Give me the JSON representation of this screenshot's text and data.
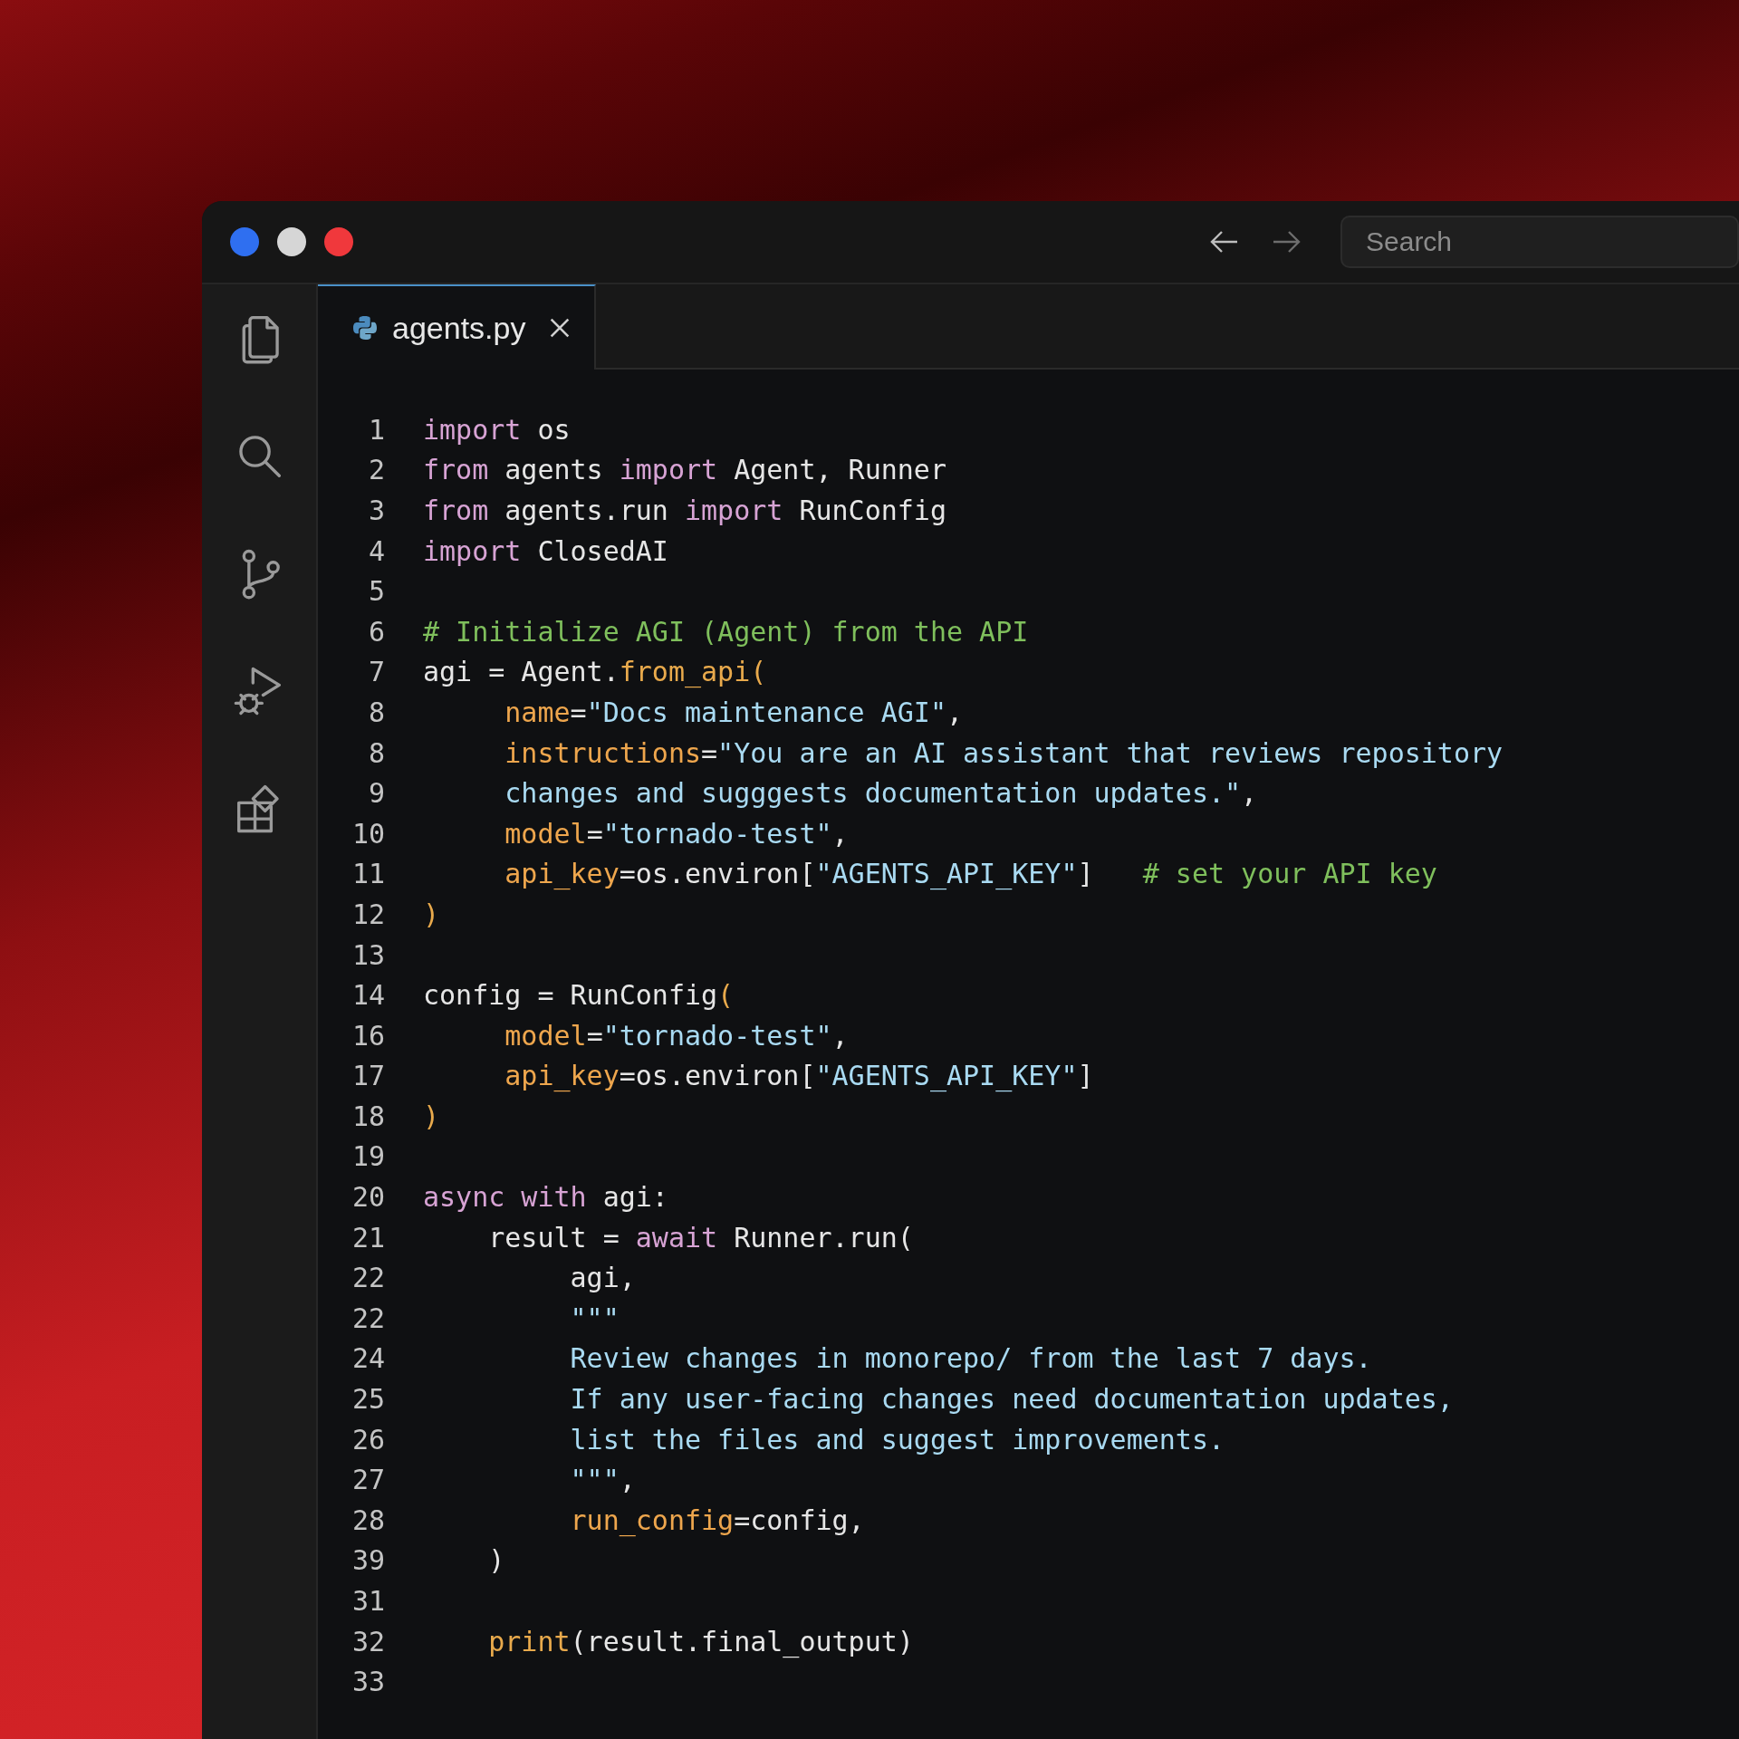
{
  "window": {
    "traffic_lights": [
      {
        "color": "#2f6ff0"
      },
      {
        "color": "#d6d6d6"
      },
      {
        "color": "#f0383c"
      }
    ],
    "search": {
      "placeholder": "Search"
    }
  },
  "activity_bar": {
    "items": [
      {
        "kind": "files",
        "selected": false
      },
      {
        "kind": "search",
        "selected": false
      },
      {
        "kind": "source-control",
        "selected": false
      },
      {
        "kind": "run-debug",
        "selected": false
      },
      {
        "kind": "extensions",
        "selected": false
      }
    ]
  },
  "tabs": [
    {
      "label": "agents.py",
      "selected": true
    }
  ],
  "editor": {
    "lines": [
      {
        "number": "1",
        "tokens": [
          {
            "kind": "keyword",
            "text": "import"
          },
          {
            "kind": "plain",
            "text": " os"
          }
        ]
      },
      {
        "number": "2",
        "tokens": [
          {
            "kind": "keyword",
            "text": "from"
          },
          {
            "kind": "plain",
            "text": " agents "
          },
          {
            "kind": "keyword",
            "text": "import"
          },
          {
            "kind": "plain",
            "text": " Agent, Runner"
          }
        ]
      },
      {
        "number": "3",
        "tokens": [
          {
            "kind": "keyword",
            "text": "from"
          },
          {
            "kind": "plain",
            "text": " agents.run "
          },
          {
            "kind": "keyword",
            "text": "import"
          },
          {
            "kind": "plain",
            "text": " RunConfig"
          }
        ]
      },
      {
        "number": "4",
        "tokens": [
          {
            "kind": "keyword",
            "text": "import"
          },
          {
            "kind": "plain",
            "text": " ClosedAI"
          }
        ]
      },
      {
        "number": "5"
      },
      {
        "number": "6",
        "tokens": [
          {
            "kind": "comment",
            "text": "# Initialize AGI (Agent) from the API"
          }
        ]
      },
      {
        "number": "7",
        "tokens": [
          {
            "kind": "plain",
            "text": "agi = Agent."
          },
          {
            "kind": "function",
            "text": "from_api("
          }
        ]
      },
      {
        "number": "8",
        "tokens": [
          {
            "kind": "param",
            "text": "     name"
          },
          {
            "kind": "plain",
            "text": "="
          },
          {
            "kind": "string",
            "text": "\"Docs maintenance AGI\""
          },
          {
            "kind": "plain",
            "text": ","
          }
        ]
      },
      {
        "number": "8",
        "tokens": [
          {
            "kind": "param",
            "text": "     instructions"
          },
          {
            "kind": "plain",
            "text": "="
          },
          {
            "kind": "string",
            "text": "\"You are an AI assistant that reviews repository"
          }
        ]
      },
      {
        "number": "9",
        "tokens": [
          {
            "kind": "string",
            "text": "     changes and sugggests documentation updates.\""
          },
          {
            "kind": "plain",
            "text": ","
          }
        ]
      },
      {
        "number": "10",
        "tokens": [
          {
            "kind": "param",
            "text": "     model"
          },
          {
            "kind": "plain",
            "text": "="
          },
          {
            "kind": "string",
            "text": "\"tornado-test\""
          },
          {
            "kind": "plain",
            "text": ","
          }
        ]
      },
      {
        "number": "11",
        "tokens": [
          {
            "kind": "param",
            "text": "     api_key"
          },
          {
            "kind": "plain",
            "text": "=os.environ["
          },
          {
            "kind": "string",
            "text": "\"AGENTS_API_KEY\""
          },
          {
            "kind": "plain",
            "text": "]"
          },
          {
            "kind": "comment",
            "text": "   # set your API key"
          }
        ]
      },
      {
        "number": "12",
        "tokens": [
          {
            "kind": "function",
            "text": ")"
          }
        ]
      },
      {
        "number": "13"
      },
      {
        "number": "14",
        "tokens": [
          {
            "kind": "plain",
            "text": "config = RunConfig"
          },
          {
            "kind": "function",
            "text": "("
          }
        ]
      },
      {
        "number": "16",
        "tokens": [
          {
            "kind": "param",
            "text": "     model"
          },
          {
            "kind": "plain",
            "text": "="
          },
          {
            "kind": "string",
            "text": "\"tornado-test\""
          },
          {
            "kind": "plain",
            "text": ","
          }
        ]
      },
      {
        "number": "17",
        "tokens": [
          {
            "kind": "param",
            "text": "     api_key"
          },
          {
            "kind": "plain",
            "text": "=os.environ["
          },
          {
            "kind": "string",
            "text": "\"AGENTS_API_KEY\""
          },
          {
            "kind": "plain",
            "text": "]"
          }
        ]
      },
      {
        "number": "18",
        "tokens": [
          {
            "kind": "function",
            "text": ")"
          }
        ]
      },
      {
        "number": "19"
      },
      {
        "number": "20",
        "tokens": [
          {
            "kind": "keyword",
            "text": "async with"
          },
          {
            "kind": "plain",
            "text": " agi:"
          }
        ]
      },
      {
        "number": "21",
        "tokens": [
          {
            "kind": "plain",
            "text": "    result = "
          },
          {
            "kind": "keyword",
            "text": "await"
          },
          {
            "kind": "plain",
            "text": " Runner.run("
          }
        ]
      },
      {
        "number": "22",
        "tokens": [
          {
            "kind": "plain",
            "text": "         agi,"
          }
        ]
      },
      {
        "number": "22",
        "tokens": [
          {
            "kind": "string",
            "text": "         \"\"\""
          }
        ]
      },
      {
        "number": "24",
        "tokens": [
          {
            "kind": "string",
            "text": "         Review changes in monorepo/ from the last 7 days."
          }
        ]
      },
      {
        "number": "25",
        "tokens": [
          {
            "kind": "string",
            "text": "         If any user-facing changes need documentation updates,"
          }
        ]
      },
      {
        "number": "26",
        "tokens": [
          {
            "kind": "string",
            "text": "         list the files and suggest improvements."
          }
        ]
      },
      {
        "number": "27",
        "tokens": [
          {
            "kind": "string",
            "text": "         \"\"\""
          },
          {
            "kind": "plain",
            "text": ","
          }
        ]
      },
      {
        "number": "28",
        "tokens": [
          {
            "kind": "param",
            "text": "         run_config"
          },
          {
            "kind": "plain",
            "text": "=config,"
          }
        ]
      },
      {
        "number": "39",
        "tokens": [
          {
            "kind": "plain",
            "text": "    )"
          }
        ]
      },
      {
        "number": "31"
      },
      {
        "number": "32",
        "tokens": [
          {
            "kind": "function",
            "text": "    print"
          },
          {
            "kind": "plain",
            "text": "(result.final_output)"
          }
        ]
      },
      {
        "number": "33"
      }
    ]
  }
}
